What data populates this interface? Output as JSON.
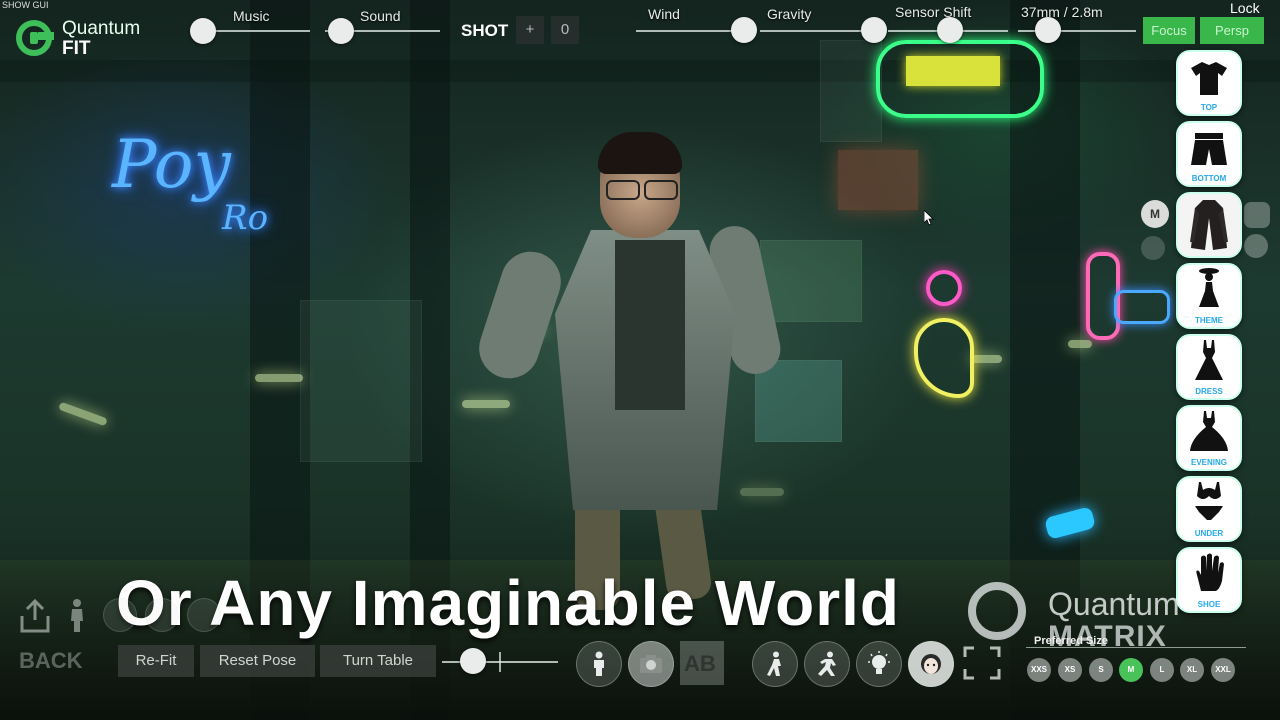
{
  "top_left": {
    "show_gui": "SHOW GUI"
  },
  "logo": {
    "line1": "Quantum",
    "line2": "FIT"
  },
  "sliders": {
    "music": {
      "label": "Music",
      "value": 0.1
    },
    "sound": {
      "label": "Sound",
      "value": 0.1
    },
    "wind": {
      "label": "Wind",
      "value": 0.8
    },
    "gravity": {
      "label": "Gravity",
      "value": 0.5
    },
    "sensor_shift": {
      "label": "Sensor Shift",
      "value": 0.5
    },
    "lens": {
      "label": "37mm / 2.8m",
      "value": 0.3
    }
  },
  "shot": {
    "label": "SHOT",
    "plus": "+",
    "count": "0"
  },
  "view_buttons": {
    "focus": "Focus",
    "persp": "Persp"
  },
  "lock": "Lock",
  "right_rail": {
    "size_badge": "M",
    "items": [
      {
        "caption": "TOP",
        "icon": "shirt-icon"
      },
      {
        "caption": "BOTTOM",
        "icon": "shorts-icon"
      },
      {
        "caption": "",
        "icon": "coat-icon"
      },
      {
        "caption": "THEME",
        "icon": "figure-icon"
      },
      {
        "caption": "DRESS",
        "icon": "dress-icon"
      },
      {
        "caption": "EVENING",
        "icon": "evening-dress-icon"
      },
      {
        "caption": "UNDER",
        "icon": "lingerie-icon"
      },
      {
        "caption": "SHOE",
        "icon": "hand-icon"
      }
    ]
  },
  "caption": "Or Any Imaginable World",
  "watermark": {
    "line1": "Quantum",
    "line2": "MATRIX"
  },
  "preferred_size": {
    "label": "Preferred Size",
    "sizes": [
      "XXS",
      "XS",
      "S",
      "M",
      "L",
      "XL",
      "XXL"
    ],
    "selected": "M"
  },
  "bottom_bar": {
    "back": "BACK",
    "refit": "Re-Fit",
    "reset_pose": "Reset Pose",
    "turn_table": "Turn Table",
    "zoom_value": 0.25,
    "icons": [
      "person-icon",
      "camera-icon",
      "ab-compare-icon",
      "walk-icon",
      "run-icon",
      "lightbulb-icon",
      "face-icon",
      "fullscreen-icon"
    ]
  },
  "colors": {
    "accent_green": "#39b74a",
    "caption_blue": "#25a9e8"
  }
}
